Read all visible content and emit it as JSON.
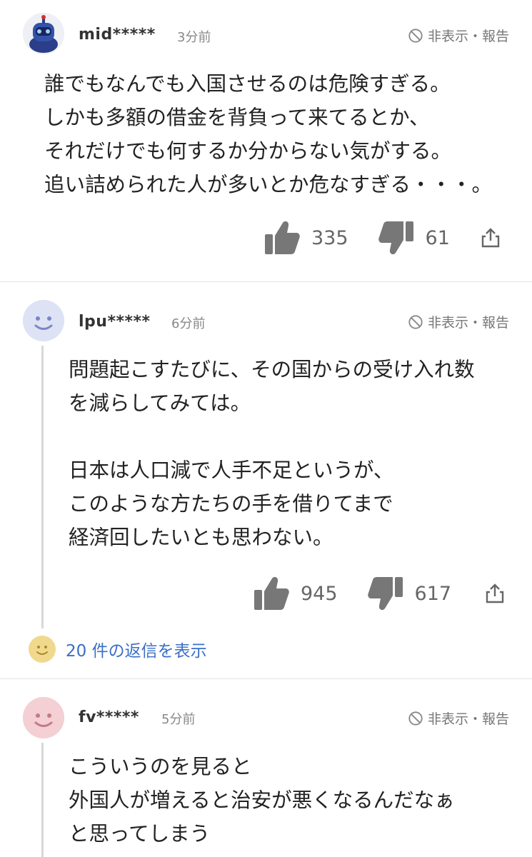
{
  "labels": {
    "hide_report": "非表示・報告"
  },
  "comments": [
    {
      "username": "mid*****",
      "time": "3分前",
      "body": "誰でもなんでも入国させるのは危険すぎる。\nしかも多額の借金を背負って来てるとか、\nそれだけでも何するか分からない気がする。\n追い詰められた人が多いとか危なすぎる・・・。",
      "likes": "335",
      "dislikes": "61"
    },
    {
      "username": "lpu*****",
      "time": "6分前",
      "body": "問題起こすたびに、その国からの受け入れ数\nを減らしてみては。\n\n日本は人口減で人手不足というが、\nこのような方たちの手を借りてまで\n経済回したいとも思わない。",
      "likes": "945",
      "dislikes": "617",
      "replies_label": "20 件の返信を表示"
    },
    {
      "username": "fv*****",
      "time": "5分前",
      "body": "こういうのを見ると\n外国人が増えると治安が悪くなるんだなぁ\nと思ってしまう"
    }
  ],
  "colors": {
    "link": "#3b6fc6",
    "avatar_blue": "#dde2f5",
    "avatar_pink": "#f4cfd3",
    "avatar_yellow": "#f0d98c"
  },
  "icons": [
    "robot-avatar",
    "smiley-avatar",
    "ban-icon",
    "thumbs-up-icon",
    "thumbs-down-icon",
    "share-icon"
  ]
}
